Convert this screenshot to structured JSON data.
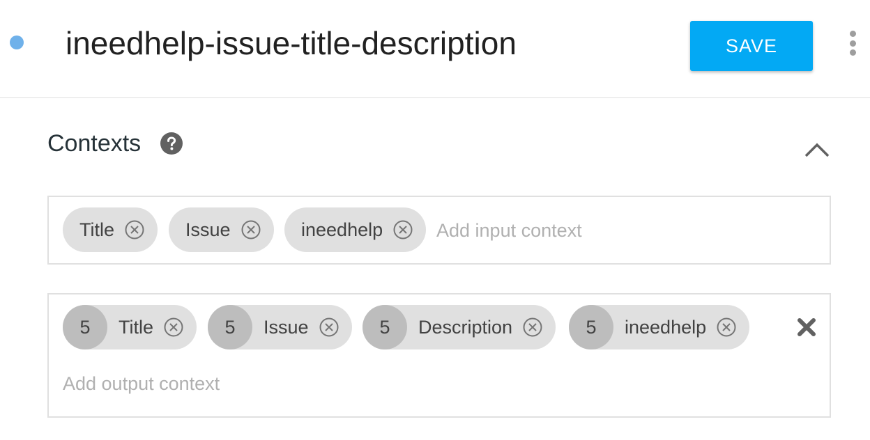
{
  "header": {
    "intent_name": "ineedhelp-issue-title-description",
    "save_label": "SAVE"
  },
  "contexts": {
    "title": "Contexts",
    "input_contexts": [
      "Title",
      "Issue",
      "ineedhelp"
    ],
    "input_placeholder": "Add input context",
    "output_contexts": [
      {
        "lifespan": "5",
        "name": "Title"
      },
      {
        "lifespan": "5",
        "name": "Issue"
      },
      {
        "lifespan": "5",
        "name": "Description"
      },
      {
        "lifespan": "5",
        "name": "ineedhelp"
      }
    ],
    "output_placeholder": "Add output context"
  },
  "icons": {
    "status": "status-dot",
    "more": "more-vert-icon",
    "help": "help-circle-icon",
    "collapse": "chevron-up-icon",
    "chip_remove": "close-circle-icon",
    "row_remove": "close-icon"
  },
  "colors": {
    "accent": "#03a9f4",
    "status_dot": "#6fb1ea",
    "chip_bg": "#e0e0e0",
    "lifespan_bg": "#bdbdbd",
    "placeholder": "#b0b0b0"
  }
}
